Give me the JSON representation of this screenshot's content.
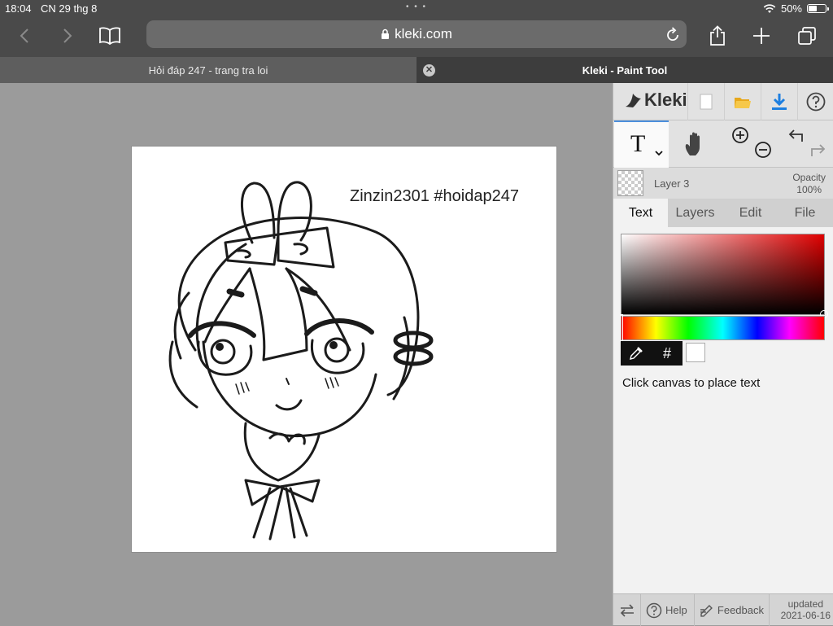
{
  "status_bar": {
    "time": "18:04",
    "date": "CN 29 thg 8",
    "battery": "50%",
    "battery_level": 0.5
  },
  "browser": {
    "url": "kleki.com",
    "tabs": [
      {
        "label": "Hỏi đáp 247 - trang tra loi"
      },
      {
        "label": "Kleki - Paint Tool"
      }
    ]
  },
  "canvas": {
    "watermark_text": "Zinzin2301 #hoidap247"
  },
  "kleki": {
    "logo": "Kleki",
    "layer": {
      "name": "Layer 3",
      "opacity_label": "Opacity",
      "opacity_value": "100%"
    },
    "tabs": [
      "Text",
      "Layers",
      "Edit",
      "File"
    ],
    "active_tab": "Text",
    "color": {
      "selected": "#ffffff",
      "hue": "#e00000",
      "hex_button": "#"
    },
    "hint": "Click canvas to place text",
    "footer": {
      "help": "Help",
      "feedback": "Feedback",
      "updated_label": "updated",
      "updated_date": "2021-06-16"
    }
  },
  "colors": {
    "accent": "#4c8fdc",
    "download": "#1e7fe0"
  }
}
